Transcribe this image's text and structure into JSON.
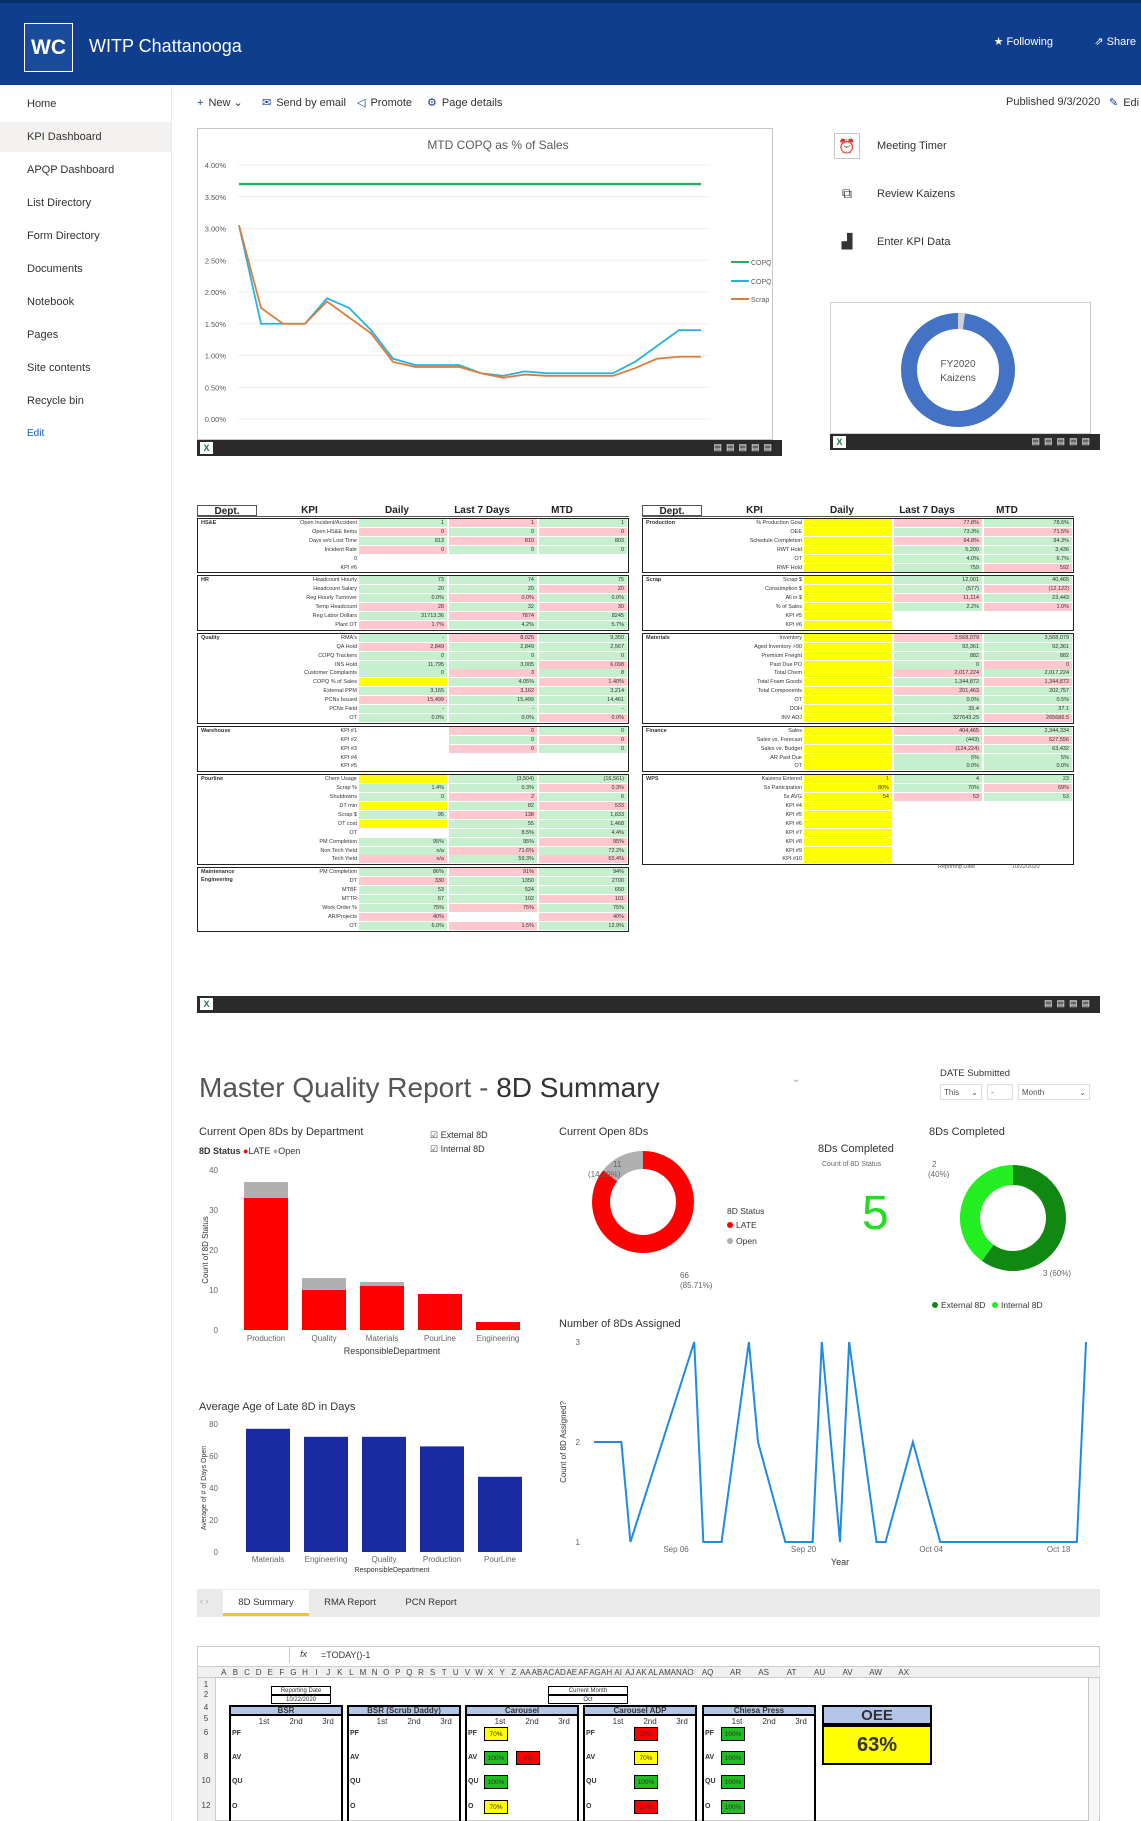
{
  "header": {
    "logo_text": "WC",
    "site_title": "WITP Chattanooga",
    "following_label": "Following",
    "share_label": "Share"
  },
  "nav": {
    "items": [
      "Home",
      "KPI Dashboard",
      "APQP Dashboard",
      "List Directory",
      "Form Directory",
      "Documents",
      "Notebook",
      "Pages",
      "Site contents",
      "Recycle bin"
    ],
    "active_index": 1,
    "edit_label": "Edit"
  },
  "commands": {
    "new": "New",
    "send_email": "Send by email",
    "promote": "Promote",
    "page_details": "Page details",
    "published": "Published 9/3/2020",
    "edit": "Edi"
  },
  "copq_chart": {
    "title": "MTD COPQ as % of Sales",
    "y_ticks": [
      "4.00%",
      "3.50%",
      "3.00%",
      "2.50%",
      "2.00%",
      "1.50%",
      "1.00%",
      "0.50%",
      "0.00%"
    ],
    "legend": [
      "COPQ Targ",
      "COPQ",
      "Scrap"
    ]
  },
  "chart_data": [
    {
      "type": "line",
      "title": "MTD COPQ as % of Sales",
      "ylim": [
        0,
        4
      ],
      "x": [
        1,
        2,
        3,
        4,
        5,
        6,
        7,
        8,
        9,
        10,
        11,
        12,
        13,
        14,
        15,
        16,
        17,
        18,
        19,
        20,
        21,
        22
      ],
      "series": [
        {
          "name": "COPQ Targ",
          "values": [
            3.7,
            3.7,
            3.7,
            3.7,
            3.7,
            3.7,
            3.7,
            3.7,
            3.7,
            3.7,
            3.7,
            3.7,
            3.7,
            3.7,
            3.7,
            3.7,
            3.7,
            3.7,
            3.7,
            3.7,
            3.7,
            3.7
          ]
        },
        {
          "name": "COPQ",
          "values": [
            3.05,
            1.5,
            1.5,
            1.5,
            1.9,
            1.75,
            1.4,
            0.95,
            0.85,
            0.85,
            0.85,
            0.72,
            0.68,
            0.75,
            0.72,
            0.72,
            0.72,
            0.72,
            0.9,
            1.15,
            1.4,
            1.4
          ]
        },
        {
          "name": "Scrap",
          "values": [
            3.05,
            1.75,
            1.5,
            1.5,
            1.85,
            1.6,
            1.35,
            0.9,
            0.82,
            0.82,
            0.82,
            0.72,
            0.65,
            0.7,
            0.68,
            0.68,
            0.68,
            0.68,
            0.8,
            0.95,
            0.98,
            0.98
          ]
        }
      ]
    },
    {
      "type": "pie",
      "title": "",
      "labels": [
        "FY2020 Kaizens"
      ],
      "values": [
        98,
        2
      ]
    },
    {
      "type": "bar",
      "title": "Current Open 8Ds by Department",
      "categories": [
        "Production",
        "Quality",
        "Materials",
        "PourLine",
        "Engineering"
      ],
      "series": [
        {
          "name": "LATE",
          "values": [
            33,
            10,
            11,
            9,
            2
          ]
        },
        {
          "name": "Open",
          "values": [
            4,
            3,
            1,
            0,
            0
          ]
        }
      ],
      "xlabel": "ResponsibleDepartment",
      "ylabel": "Count of 8D Status",
      "ylim": [
        0,
        40
      ]
    },
    {
      "type": "pie",
      "title": "Current Open 8Ds",
      "labels": [
        "LATE",
        "Open"
      ],
      "values": [
        66,
        11
      ]
    },
    {
      "type": "pie",
      "title": "8Ds Completed",
      "labels": [
        "External 8D",
        "Internal 8D"
      ],
      "values": [
        3,
        2
      ]
    },
    {
      "type": "bar",
      "title": "Average Age of Late 8D in Days",
      "categories": [
        "Materials",
        "Engineering",
        "Quality",
        "Production",
        "PourLine"
      ],
      "values": [
        77,
        72,
        72,
        66,
        47
      ],
      "xlabel": "ResponsibleDepartment",
      "ylabel": "Average of # of Days Open",
      "ylim": [
        0,
        80
      ]
    },
    {
      "type": "line",
      "title": "Number of 8Ds Assigned",
      "xlabel": "Year",
      "ylabel": "Count of 8D Assigned?",
      "ylim": [
        1,
        3
      ],
      "x": [
        "Aug 28",
        "Aug 31",
        "Sep 01",
        "Sep 08",
        "Sep 09",
        "Sep 11",
        "Sep 14",
        "Sep 15",
        "Sep 18",
        "Sep 21",
        "Sep 22",
        "Sep 24",
        "Sep 25",
        "Sep 28",
        "Sep 29",
        "Oct 02",
        "Oct 05",
        "Oct 06",
        "Oct 09",
        "Oct 12",
        "Oct 15",
        "Oct 19",
        "Oct 20",
        "Oct 21"
      ],
      "values": [
        2,
        2,
        1,
        3,
        1,
        1,
        3,
        2,
        1,
        1,
        3,
        1,
        3,
        1,
        1,
        2,
        1,
        1,
        1,
        1,
        1,
        1,
        1,
        3
      ]
    }
  ],
  "kaizen": {
    "label_line1": "FY2020",
    "label_line2": "Kaizens"
  },
  "quicklinks": [
    "Meeting Timer",
    "Review Kaizens",
    "Enter KPI Data"
  ],
  "kpi_left": {
    "headers": [
      "Dept.",
      "KPI",
      "Daily",
      "Last 7 Days",
      "MTD"
    ],
    "groups": [
      {
        "dept": "HS&E",
        "rows": [
          [
            "Open Incident/Accident",
            "1",
            "1",
            "1"
          ],
          [
            "Open HS&E Items",
            "0",
            "0",
            "0"
          ],
          [
            "Days w/o Lost Time",
            "813",
            "810",
            "803"
          ],
          [
            "Incident Rate",
            "0",
            "0",
            "0"
          ],
          [
            "0",
            "",
            "",
            ""
          ],
          [
            "KPI #6",
            "",
            "",
            ""
          ]
        ]
      },
      {
        "dept": "HR",
        "rows": [
          [
            "Headcount Hourly",
            "73",
            "74",
            "75"
          ],
          [
            "Headcount Salary",
            "20",
            "20",
            "20"
          ],
          [
            "Reg Hourly Turnover",
            "0.0%",
            "0.0%",
            "0.0%"
          ],
          [
            "Temp Headcount",
            "28",
            "32",
            "30"
          ],
          [
            "Reg Labor Dollars",
            "31713.36",
            "7874",
            "8245"
          ],
          [
            "Plant OT",
            "1.7%",
            "4.2%",
            "5.7%"
          ]
        ]
      },
      {
        "dept": "Quality",
        "rows": [
          [
            "RMA's",
            "-",
            "8,025",
            "9,350"
          ],
          [
            "QA Hold",
            "2,849",
            "2,849",
            "2,567"
          ],
          [
            "COPQ Trackers",
            "0",
            "0",
            "0"
          ],
          [
            "INS Hold",
            "11,795",
            "3,005",
            "6,098"
          ],
          [
            "Customer Complaints",
            "0",
            "3",
            "8"
          ],
          [
            "COPQ % of Sales",
            "",
            "4.05%",
            "1.40%"
          ],
          [
            "External PPM",
            "3,165",
            "3,162",
            "3,214"
          ],
          [
            "PCNs Issued",
            "15,499",
            "15,499",
            "14,461"
          ],
          [
            "PCNs Field",
            "-",
            "-",
            "-"
          ],
          [
            "OT",
            "0.0%",
            "0.0%",
            "0.0%"
          ]
        ]
      },
      {
        "dept": "Warehouse",
        "rows": [
          [
            "KPI #1",
            "",
            "0",
            "0"
          ],
          [
            "KPI #2",
            "",
            "0",
            "0"
          ],
          [
            "KPI #3",
            "",
            "0",
            "0"
          ],
          [
            "KPI #4",
            "",
            "",
            ""
          ],
          [
            "KPI #5",
            "",
            "",
            ""
          ]
        ]
      },
      {
        "dept": "Pourline",
        "rows": [
          [
            "Chem Usage",
            "",
            "(3,504)",
            "(16,561)"
          ],
          [
            "Scrap %",
            "1.4%",
            "0.3%",
            "0.3%"
          ],
          [
            "Shutdowns",
            "0",
            "2",
            "6"
          ],
          [
            "DT min",
            "",
            "82",
            "533"
          ],
          [
            "Scrap $",
            "95",
            "138",
            "1,833"
          ],
          [
            "DT cost",
            "",
            "55",
            "1,468"
          ],
          [
            "OT",
            "",
            "8.5%",
            "4.4%"
          ],
          [
            "PM Completion",
            "95%",
            "95%",
            "95%"
          ],
          [
            "Non Tech Yield",
            "n/a",
            "71.6%",
            "72.2%"
          ],
          [
            "Tech Yield",
            "n/a",
            "59.3%",
            "65.4%"
          ]
        ]
      },
      {
        "dept": "Maintenance Engineering",
        "rows": [
          [
            "PM Completion",
            "86%",
            "91%",
            "94%"
          ],
          [
            "DT",
            "330",
            "1350",
            "2700"
          ],
          [
            "MTBF",
            "53",
            "524",
            "650"
          ],
          [
            "MTTR",
            "67",
            "102",
            "101"
          ],
          [
            "Work Order %",
            "75%",
            "75%",
            "75%"
          ],
          [
            "AR/Projects",
            "40%",
            "",
            "40%"
          ],
          [
            "OT",
            "6.0%",
            "1.5%",
            "12.9%"
          ]
        ]
      }
    ]
  },
  "kpi_right": {
    "headers": [
      "Dept.",
      "KPI",
      "Daily",
      "Last 7 Days",
      "MTD"
    ],
    "groups": [
      {
        "dept": "Production",
        "rows": [
          [
            "% Production Goal",
            "",
            "77.8%",
            "78.6%"
          ],
          [
            "OEE",
            "",
            "73.3%",
            "71.5%"
          ],
          [
            "Schedule Completion",
            "",
            "94.8%",
            "94.3%"
          ],
          [
            "RWT Hold",
            "",
            "5,200",
            "3,436"
          ],
          [
            "OT",
            "",
            "4.0%",
            "6.7%"
          ],
          [
            "RWF Hold",
            "",
            "759",
            "592"
          ]
        ]
      },
      {
        "dept": "Scrap",
        "rows": [
          [
            "Scrap $",
            "",
            "12,001",
            "40,465"
          ],
          [
            "Consumption $",
            "",
            "(577)",
            "(12,122)"
          ],
          [
            "All in $",
            "",
            "11,114",
            "23,443"
          ],
          [
            "% of Sales",
            "",
            "2.2%",
            "1.0%"
          ],
          [
            "KPI #5",
            "",
            "",
            ""
          ],
          [
            "KPI #6",
            "",
            "",
            ""
          ]
        ]
      },
      {
        "dept": "Materials",
        "rows": [
          [
            "Inventory",
            "",
            "3,568,079",
            "3,568,079"
          ],
          [
            "Aged Inventory >90",
            "",
            "92,361",
            "92,361"
          ],
          [
            "Premium Freight",
            "",
            "882",
            "882"
          ],
          [
            "Past Due PO",
            "",
            "0",
            "0"
          ],
          [
            "Total Chem",
            "",
            "2,017,224",
            "2,017,224"
          ],
          [
            "Total Foam Goods",
            "",
            "1,344,872",
            "1,344,872"
          ],
          [
            "Total Components",
            "",
            "201,463",
            "202,757"
          ],
          [
            "OT",
            "",
            "0.0%",
            "0.5%"
          ],
          [
            "DOH",
            "",
            "35.4",
            "37.1"
          ],
          [
            "INV ADJ",
            "",
            "327643.25",
            "265686.5"
          ]
        ]
      },
      {
        "dept": "Finance",
        "rows": [
          [
            "Sales",
            "",
            "404,465",
            "2,344,334"
          ],
          [
            "Sales vs. Forecast",
            "",
            "(443)",
            "527,556"
          ],
          [
            "Sales vs. Budget",
            "",
            "(124,224)",
            "63,432"
          ],
          [
            "AR Past Due",
            "",
            "5%",
            "5%"
          ],
          [
            "OT",
            "",
            "0.0%",
            "0.0%"
          ]
        ]
      },
      {
        "dept": "WPS",
        "rows": [
          [
            "Kaizens Entered",
            "1",
            "4",
            "23"
          ],
          [
            "Ss Participation",
            "80%",
            "70%",
            "69%"
          ],
          [
            "5s AVG",
            "54",
            "53",
            "53"
          ],
          [
            "KPI #4",
            "",
            "",
            ""
          ],
          [
            "KPI #5",
            "",
            "",
            ""
          ],
          [
            "KPI #6",
            "",
            "",
            ""
          ],
          [
            "KPI #7",
            "",
            "",
            ""
          ],
          [
            "KPI #8",
            "",
            "",
            ""
          ],
          [
            "KPI #9",
            "",
            "",
            ""
          ],
          [
            "KPI #10",
            "",
            "",
            ""
          ]
        ]
      }
    ],
    "reporting_label": "Reporting Date",
    "reporting_date": "10/22/2020"
  },
  "pbi": {
    "title_light": "Master Quality Report - ",
    "title_dark": "8D Summary",
    "date_submitted": "DATE Submitted",
    "filter_this": "This",
    "filter_dash": "-",
    "filter_month": "Month",
    "v1_title": "Current Open 8Ds by Department",
    "v1_legend_title": "8D Status",
    "v1_legend_late": "LATE",
    "v1_legend_open": "Open",
    "v1_y_ticks": [
      "40",
      "30",
      "20",
      "10",
      "0"
    ],
    "check_external": "External 8D",
    "check_internal": "Internal 8D",
    "v2_title": "Current Open 8Ds",
    "v2_open_label": "11",
    "v2_open_pct": "(14.29%)",
    "v2_late_label": "66",
    "v2_late_pct": "(85.71%)",
    "v2_legend_title": "8D Status",
    "v2_legend_late": "LATE",
    "v2_legend_open": "Open",
    "v3_title": "8Ds Completed",
    "v3_sub": "Count of 8D Status",
    "v3_value": "5",
    "v4_title": "8Ds Completed",
    "v4_small_label": "2",
    "v4_small_pct": "(40%)",
    "v4_big_label": "3 (60%)",
    "v4_legend_external": "External 8D",
    "v4_legend_internal": "Internal 8D",
    "v5_title": "Average Age of Late 8D in Days",
    "v5_y_ticks": [
      "80",
      "60",
      "40",
      "20",
      "0"
    ],
    "v6_title": "Number of 8Ds Assigned",
    "v6_y_ticks": [
      "3",
      "2",
      "1"
    ],
    "v6_x_ticks": [
      "Sep 06",
      "Sep 20",
      "Oct 04",
      "Oct 18"
    ],
    "tabs": [
      "8D Summary",
      "RMA Report",
      "PCN Report"
    ]
  },
  "sheet": {
    "formula": "=TODAY()-1",
    "fx": "fx",
    "cols": [
      "A",
      "B",
      "C",
      "D",
      "E",
      "F",
      "G",
      "H",
      "I",
      "J",
      "K",
      "L",
      "M",
      "N",
      "O",
      "P",
      "Q",
      "R",
      "S",
      "T",
      "U",
      "V",
      "W",
      "X",
      "Y",
      "Z",
      "AA",
      "AB",
      "AC",
      "AD",
      "AE",
      "AF",
      "AG",
      "AH",
      "AI",
      "AJ",
      "AK",
      "AL",
      "AM",
      "AN",
      "AO",
      "AQ",
      "AR",
      "AS",
      "AT",
      "AU",
      "AV",
      "AW",
      "AX"
    ],
    "rows": [
      "1",
      "2",
      "4",
      "5",
      "6",
      "8",
      "10",
      "12"
    ],
    "reporting_label": "Reporting Date",
    "reporting_date": "10/22/2020",
    "current_month_label": "Current Month",
    "current_month_value": "Oct",
    "shifts": [
      "1st",
      "2nd",
      "3rd"
    ],
    "row_labels": [
      "PF",
      "AV",
      "QU",
      "O"
    ],
    "blocks": [
      {
        "name": "BSR",
        "cells": [
          [
            "",
            "",
            ""
          ],
          [
            "",
            "",
            ""
          ],
          [
            "",
            "",
            ""
          ],
          [
            "",
            "",
            ""
          ]
        ]
      },
      {
        "name": "BSR (Scrub Daddy)",
        "cells": [
          [
            "",
            "",
            ""
          ],
          [
            "",
            "",
            ""
          ],
          [
            "",
            "",
            ""
          ],
          [
            "",
            "",
            ""
          ]
        ]
      },
      {
        "name": "Carousel",
        "cells": [
          [
            "70%",
            "",
            ""
          ],
          [
            "100%",
            "4%",
            ""
          ],
          [
            "100%",
            "",
            ""
          ],
          [
            "70%",
            "",
            ""
          ]
        ]
      },
      {
        "name": "Carousel ADP",
        "cells": [
          [
            "",
            "28%",
            ""
          ],
          [
            "",
            "70%",
            ""
          ],
          [
            "",
            "100%",
            ""
          ],
          [
            "",
            "19%",
            ""
          ]
        ]
      },
      {
        "name": "Chiesa Press",
        "cells": [
          [
            "100%",
            "",
            ""
          ],
          [
            "100%",
            "",
            ""
          ],
          [
            "100%",
            "",
            ""
          ],
          [
            "100%",
            "",
            ""
          ]
        ]
      }
    ],
    "oee_label": "OEE",
    "oee_value": "63%"
  },
  "colors": {
    "header_bg": "#0f3e8c",
    "pink": "#ffc7ce",
    "green": "#c6efce",
    "yellow": "#ffff00",
    "late_red": "#ff0000",
    "open_gray": "#b0b0b0",
    "bar_blue": "#1a2aa0",
    "line_blue": "#1f8be0",
    "copq_green": "#27ae60",
    "copq_cyan": "#22b4e0",
    "copq_orange": "#e07b39"
  }
}
